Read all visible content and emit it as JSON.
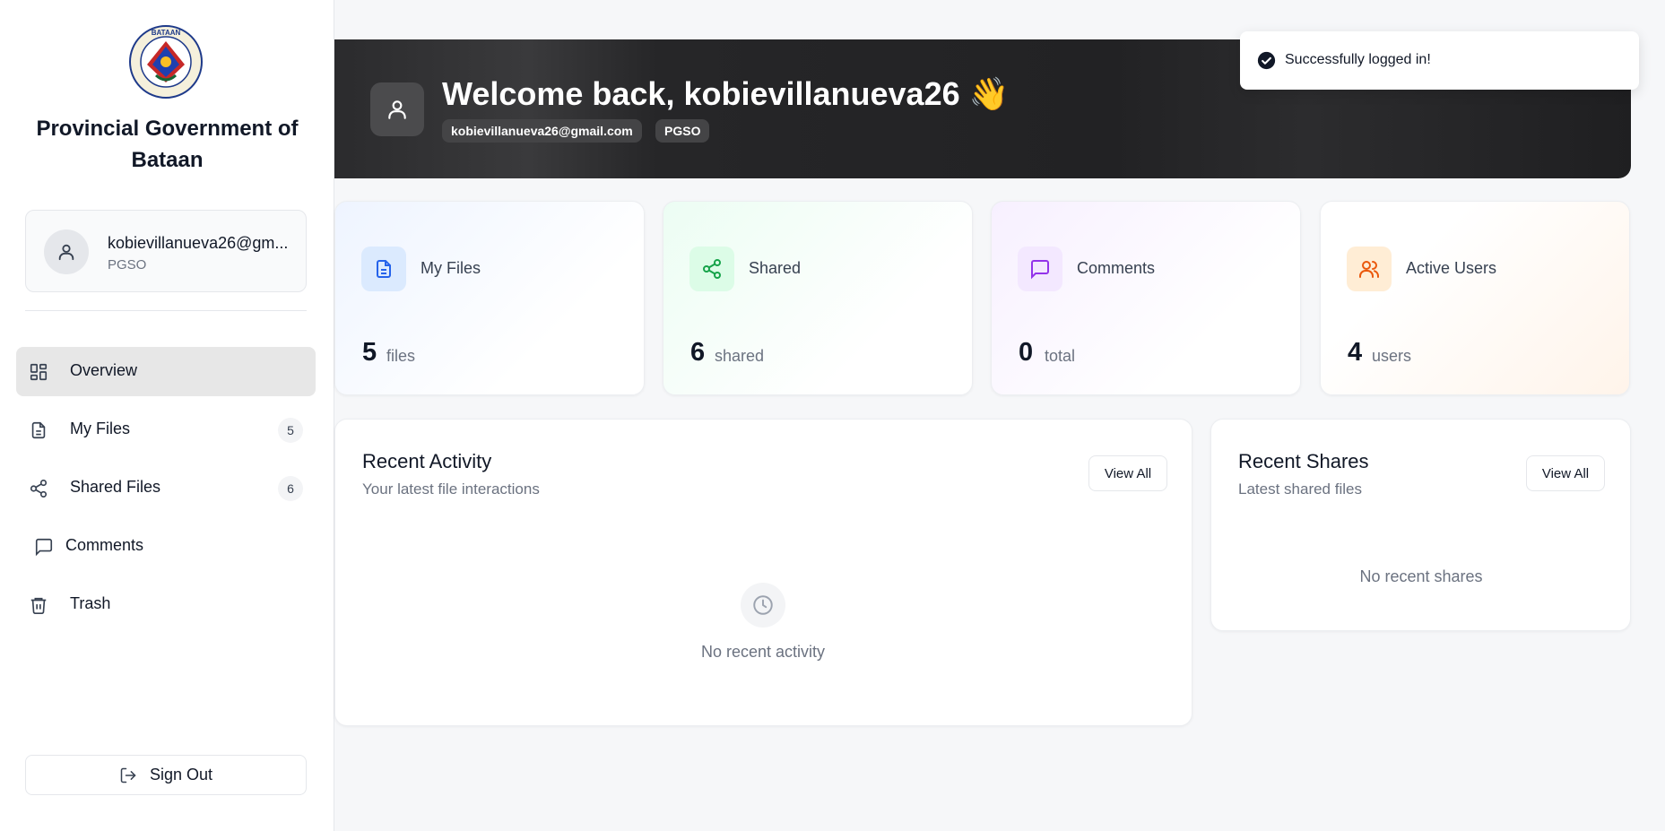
{
  "sidebar": {
    "org_name": "Provincial Government of Bataan",
    "seal_text": "BATAAN · SARISAG NG LALAWIGAN",
    "user": {
      "email": "kobievillanueva26@gm...",
      "department": "PGSO"
    },
    "nav": [
      {
        "label": "Overview",
        "icon": "dashboard-icon",
        "count": null,
        "active": true
      },
      {
        "label": "My Files",
        "icon": "file-icon",
        "count": "5"
      },
      {
        "label": "Shared Files",
        "icon": "share-icon",
        "count": "6"
      },
      {
        "label": "Comments",
        "icon": "comment-icon",
        "count": null
      },
      {
        "label": "Trash",
        "icon": "trash-icon",
        "count": null
      }
    ],
    "sign_out": "Sign Out"
  },
  "hero": {
    "title": "Welcome back, kobievillanueva26 👋",
    "email": "kobievillanueva26@gmail.com",
    "department": "PGSO"
  },
  "toast": {
    "message": "Successfully logged in!"
  },
  "stats": [
    {
      "label": "My Files",
      "value": "5",
      "unit": "files",
      "icon": "file-icon",
      "color": "#2563eb"
    },
    {
      "label": "Shared",
      "value": "6",
      "unit": "shared",
      "icon": "share-icon",
      "color": "#16a34a"
    },
    {
      "label": "Comments",
      "value": "0",
      "unit": "total",
      "icon": "comment-icon",
      "color": "#9333ea"
    },
    {
      "label": "Active Users",
      "value": "4",
      "unit": "users",
      "icon": "users-icon",
      "color": "#ea580c"
    }
  ],
  "recent_activity": {
    "title": "Recent Activity",
    "subtitle": "Your latest file interactions",
    "view_all": "View All",
    "empty": "No recent activity"
  },
  "recent_shares": {
    "title": "Recent Shares",
    "subtitle": "Latest shared files",
    "view_all": "View All",
    "empty": "No recent shares"
  }
}
